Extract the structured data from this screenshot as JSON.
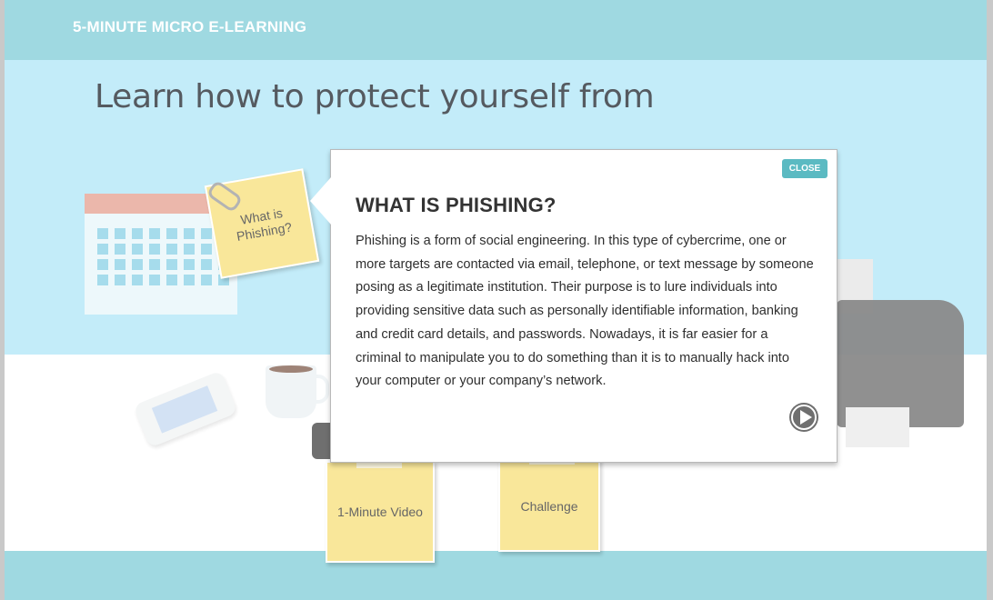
{
  "header": {
    "brand": "5-MINUTE MICRO E-LEARNING"
  },
  "main": {
    "headline": "Learn how to protect yourself from"
  },
  "notes": {
    "what_is": "What is Phishing?",
    "video": "1-Minute Video",
    "challenge": "Challenge"
  },
  "popup": {
    "close_label": "CLOSE",
    "title": "WHAT IS PHISHING?",
    "body": "Phishing is a form of social engineering. In this type of cybercrime, one or more targets are contacted via email, telephone, or text message by someone posing as a legitimate institution. Their purpose is to lure individuals into providing sensitive data such as personally identifiable information, banking and credit card details, and passwords. Nowadays, it is far easier for a criminal to manipulate you to do something than it is to manually hack into your computer or your company’s network."
  },
  "icons": {
    "play": "play-icon",
    "calendar": "calendar-icon",
    "phone": "phone-icon",
    "cup": "cup-icon",
    "printer": "printer-icon",
    "paperclip": "paperclip-icon"
  },
  "colors": {
    "topbar": "#9fd9e1",
    "background": "#c3ecf9",
    "accent": "#5bbac2",
    "sticky": "#f9e79a"
  }
}
